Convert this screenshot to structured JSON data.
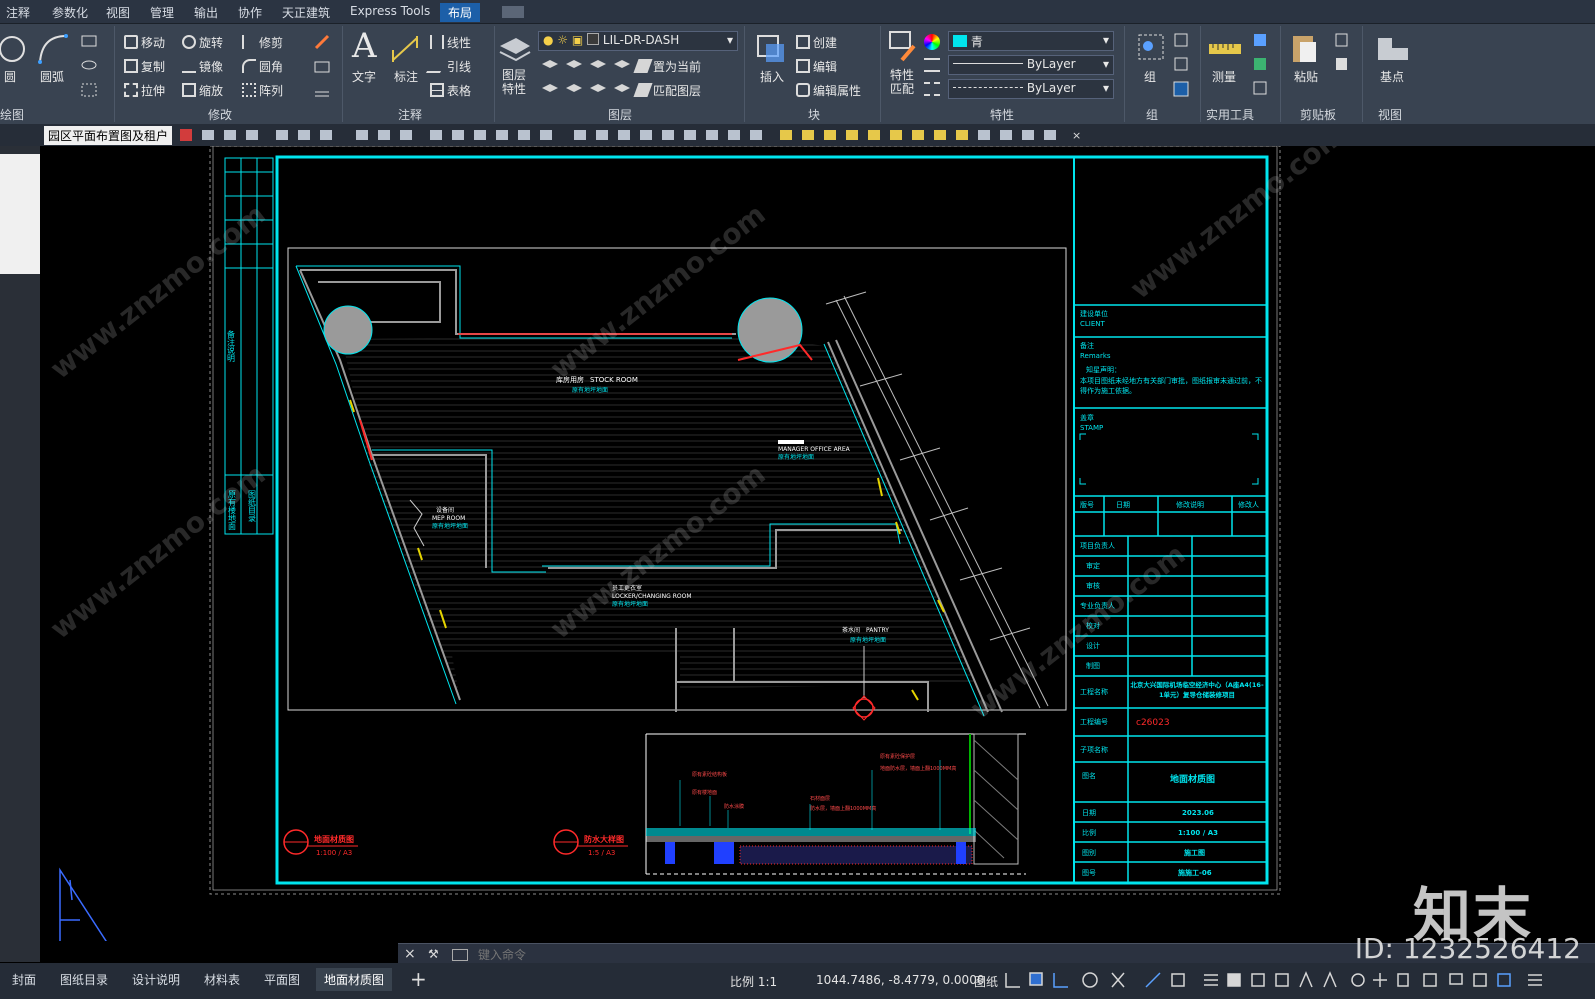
{
  "menubar": {
    "items": [
      "注释",
      "参数化",
      "视图",
      "管理",
      "输出",
      "协作",
      "天正建筑",
      "Express Tools",
      "布局"
    ],
    "active": "布局"
  },
  "ribbon": {
    "draw": {
      "circle": "圆",
      "arc": "圆弧",
      "panel": "绘图"
    },
    "modify": {
      "move": "移动",
      "rotate": "旋转",
      "trim": "修剪",
      "copy": "复制",
      "mirror": "镜像",
      "fillet": "圆角",
      "stretch": "拉伸",
      "scale": "缩放",
      "array": "阵列",
      "panel": "修改"
    },
    "annotation": {
      "text": "文字",
      "dimension": "标注",
      "leader": "线性",
      "multileader": "引线",
      "table": "表格",
      "panel": "注释"
    },
    "layers": {
      "props": "图层\n特性",
      "current_layer": "LIL-DR-DASH",
      "set_current": "置为当前",
      "match_layer": "匹配图层",
      "panel": "图层"
    },
    "block": {
      "insert": "插入",
      "create": "创建",
      "edit": "编辑",
      "edit_attr": "编辑属性",
      "panel": "块"
    },
    "properties": {
      "match": "特性\n匹配",
      "color": "青",
      "linetype": "ByLayer",
      "lineweight": "ByLayer",
      "panel": "特性"
    },
    "group": {
      "group": "组",
      "panel": "组"
    },
    "utilities": {
      "measure": "测量",
      "panel": "实用工具"
    },
    "clipboard": {
      "paste": "粘贴",
      "panel": "剪贴板"
    },
    "view": {
      "base": "基点",
      "panel": "视图"
    }
  },
  "document_tab": "园区平面布置图及租户",
  "drawing": {
    "rooms": [
      {
        "cn": "库房用房",
        "en": "STOCK ROOM",
        "mat": "原有地坪地面"
      },
      {
        "cn": "",
        "en": "MANAGER OFFICE AREA",
        "mat": "原有地坪地面"
      },
      {
        "cn": "设备间",
        "en": "MEP ROOM",
        "mat": "原有地坪地面"
      },
      {
        "cn": "员工更衣室",
        "en": "LOCKER/CHANGING ROOM",
        "mat": "原有地坪地面"
      },
      {
        "cn": "茶水间",
        "en": "PANTRY",
        "mat": "原有地坪地面"
      }
    ],
    "titles": [
      {
        "name": "地面材质图",
        "scale": "1:100 / A3"
      },
      {
        "name": "防水大样图",
        "scale": "1:5 / A3"
      }
    ],
    "detail_notes": [
      "原有素砼结构板",
      "原有楼地面",
      "防水涂膜",
      "地面防水层，墙面上翻1000MM高",
      "石材面层",
      "防水层，墙面上翻1000MM高",
      "原有素砼保护层"
    ],
    "left_strip": [
      "备注说明",
      "原有楼地面",
      "图纸目录"
    ]
  },
  "titleblock": {
    "client_label": "建设单位",
    "client_en": "CLIENT",
    "remarks_label": "备注",
    "remarks_en": "Remarks",
    "statement_label": "知星声明：",
    "statement": "本项目图纸未经地方有关部门审批，图纸报审未通过前，不得作为施工依据。",
    "stamp_label": "盖章",
    "stamp_en": "STAMP",
    "rev_headers": [
      "版号",
      "日期",
      "修改说明",
      "修改人"
    ],
    "roles": [
      "项目负责人",
      "审定",
      "审核",
      "专业负责人",
      "校对",
      "设计",
      "制图"
    ],
    "project_label": "工程名称",
    "project_name": "北京大兴国际机场临空经济中心（A座A4(16-1单元）复导仓储装修项目",
    "project_no_label": "工程编号",
    "project_no": "c26023",
    "sub_label": "子项名称",
    "drawing_label": "图名",
    "drawing_name": "地面材质图",
    "date_label": "日期",
    "date": "2023.06",
    "scale_label": "比例",
    "scale": "1:100 / A3",
    "stage_label": "图别",
    "stage": "施工图",
    "no_label": "图号",
    "no": "施施工-06"
  },
  "command": {
    "placeholder": "键入命令"
  },
  "status": {
    "tabs": [
      "封面",
      "图纸目录",
      "设计说明",
      "材料表",
      "平面图",
      "地面材质图"
    ],
    "active_tab": "地面材质图",
    "scale": "比例 1:1",
    "coords": "1044.7486, -8.4779, 0.0000",
    "space": "图纸"
  },
  "watermark": {
    "brand": "知末",
    "id": "ID: 1232526412",
    "site": "www.znzmo.com"
  },
  "colors": {
    "cyan": "#00e5ee",
    "red": "#ff2a2a",
    "white": "#ffffff",
    "grey": "#a6a6a6",
    "yellow": "#e5d400",
    "green": "#00b400"
  }
}
